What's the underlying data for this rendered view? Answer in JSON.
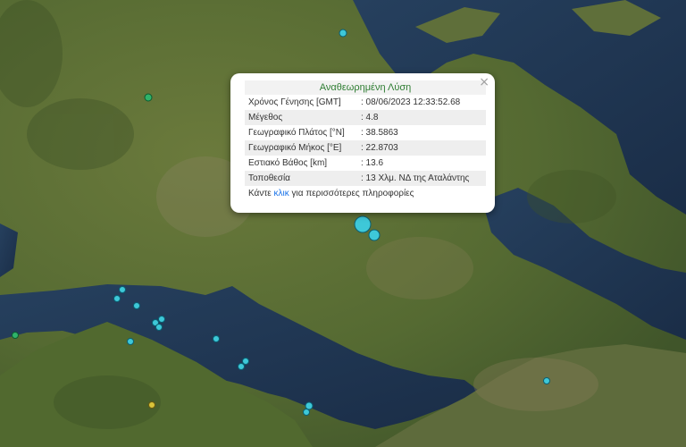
{
  "popup": {
    "title": "Αναθεωρημένη Λύση",
    "rows": [
      {
        "label": "Χρόνος Γένησης [GMT]",
        "value": ": 08/06/2023 12:33:52.68"
      },
      {
        "label": "Μέγεθος",
        "value": ": 4.8"
      },
      {
        "label": "Γεωγραφικό Πλάτος [°N]",
        "value": ": 38.5863"
      },
      {
        "label": "Γεωγραφικό Μήκος [°E]",
        "value": ": 22.8703"
      },
      {
        "label": "Εστιακό Βάθος [km]",
        "value": ": 13.6"
      },
      {
        "label": "Τοποθεσία",
        "value": ": 13 Χλμ. ΝΔ της Αταλάντης"
      }
    ],
    "more_prefix": "Κάντε",
    "more_link": "κλικ",
    "more_suffix": "για περισσότερες πληροφορίες",
    "close_icon": "×"
  },
  "colors": {
    "marker_cyan": "#3ec8d8",
    "marker_green": "#2fb36a",
    "marker_yellow": "#d9c43a",
    "title_green": "#2e7d32",
    "link_blue": "#1a73e8"
  }
}
